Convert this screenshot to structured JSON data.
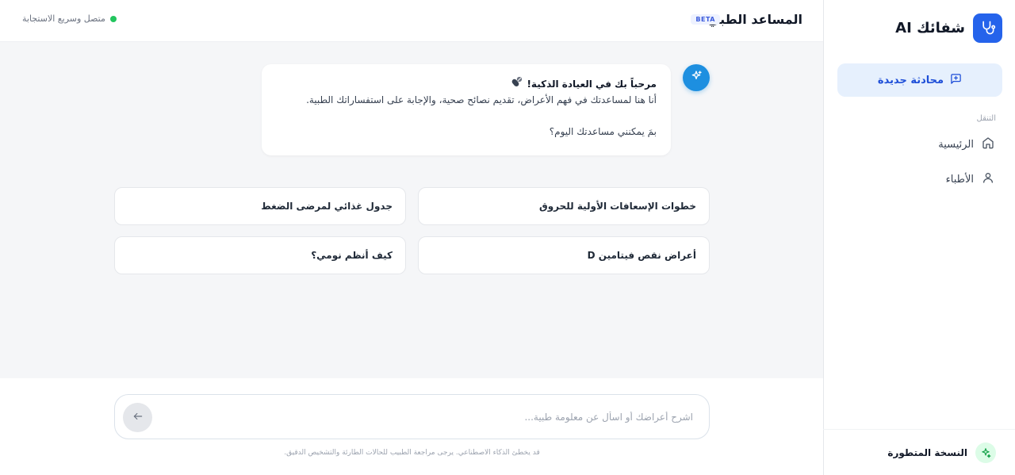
{
  "sidebar": {
    "brand_name": "شفائك AI",
    "new_chat_label": "محادثة جديدة",
    "nav_label": "التنقل",
    "items": [
      {
        "label": "الرئيسية",
        "icon": "home-icon"
      },
      {
        "label": "الأطباء",
        "icon": "user-icon"
      }
    ],
    "footer_label": "النسخة المتطورة"
  },
  "header": {
    "title": "المساعد الطبي",
    "badge": "BETA",
    "status": "متصل وسريع الاستجابة"
  },
  "welcome": {
    "title": "مرحباً بك في العيادة الذكية!",
    "body": "أنا هنا لمساعدتك في فهم الأعراض، تقديم نصائح صحية، والإجابة على استفساراتك الطبية.",
    "question": "بمَ يمكنني مساعدتك اليوم؟"
  },
  "suggestions": [
    "خطوات الإسعافات الأولية للحروق",
    "جدول غذائي لمرضى الضغط",
    "أعراض نقص فيتامين D",
    "كيف أنظم نومي؟"
  ],
  "input": {
    "placeholder": "اشرح أعراضك أو اسأل عن معلومة طبية...",
    "value": ""
  },
  "disclaimer": "قد يخطئ الذكاء الاصطناعي. يرجى مراجعة الطبيب للحالات الطارئة والتشخيص الدقيق.",
  "colors": {
    "accent": "#2563eb",
    "accent_light": "#e6f0fd",
    "bot_avatar": "#1d8fe0",
    "status": "#22c55e",
    "chat_bg": "#f5f6f8"
  }
}
